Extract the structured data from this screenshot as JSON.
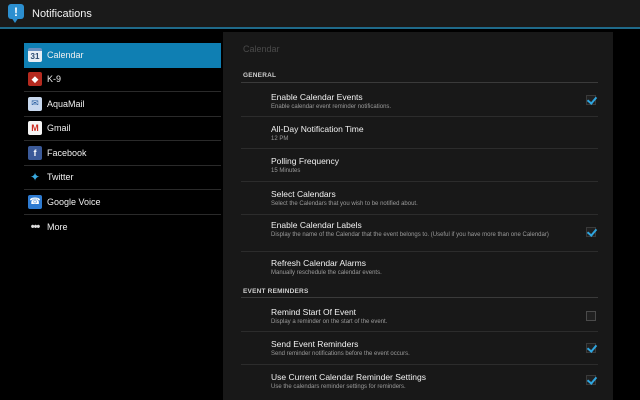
{
  "actionbar": {
    "title": "Notifications",
    "icon": "notification-bubble-icon"
  },
  "sidebar": {
    "items": [
      {
        "label": "Calendar",
        "icon": "calendar-icon",
        "glyph": "31",
        "active": true
      },
      {
        "label": "K-9",
        "icon": "k9-icon",
        "glyph": "◆"
      },
      {
        "label": "AquaMail",
        "icon": "aquamail-icon",
        "glyph": "✉"
      },
      {
        "label": "Gmail",
        "icon": "gmail-icon",
        "glyph": "M"
      },
      {
        "label": "Facebook",
        "icon": "facebook-icon",
        "glyph": "f"
      },
      {
        "label": "Twitter",
        "icon": "twitter-icon",
        "glyph": "🐦"
      },
      {
        "label": "Google Voice",
        "icon": "google-voice-icon",
        "glyph": "☎"
      },
      {
        "label": "More",
        "icon": "more-icon",
        "glyph": "•••"
      }
    ]
  },
  "panel": {
    "title": "Calendar",
    "general_header": "GENERAL",
    "reminders_header": "EVENT REMINDERS",
    "general": [
      {
        "title": "Enable Calendar Events",
        "summary": "Enable calendar event reminder notifications.",
        "checkbox": true,
        "checked": true
      },
      {
        "title": "All-Day Notification Time",
        "summary": "12 PM",
        "checkbox": false
      },
      {
        "title": "Polling Frequency",
        "summary": "15 Minutes",
        "checkbox": false
      },
      {
        "title": "Select Calendars",
        "summary": "Select the Calendars that you wish to be notified about.",
        "checkbox": false
      },
      {
        "title": "Enable Calendar Labels",
        "summary": "Display the name of the Calendar that the event belongs to. (Useful if you have more than one Calendar)",
        "checkbox": true,
        "checked": true
      },
      {
        "title": "Refresh Calendar Alarms",
        "summary": "Manually reschedule the calendar events.",
        "checkbox": false
      }
    ],
    "reminders": [
      {
        "title": "Remind Start Of Event",
        "summary": "Display a reminder on the start of the event.",
        "checkbox": true,
        "checked": false
      },
      {
        "title": "Send Event Reminders",
        "summary": "Send reminder notifications before the event occurs.",
        "checkbox": true,
        "checked": true
      },
      {
        "title": "Use Current Calendar Reminder Settings",
        "summary": "Use the calendars reminder settings for reminders.",
        "checkbox": true,
        "checked": true
      }
    ]
  },
  "colors": {
    "accent": "#0f7fb3",
    "check": "#2fa6e0",
    "actionbar_line": "#1f6a8a"
  }
}
